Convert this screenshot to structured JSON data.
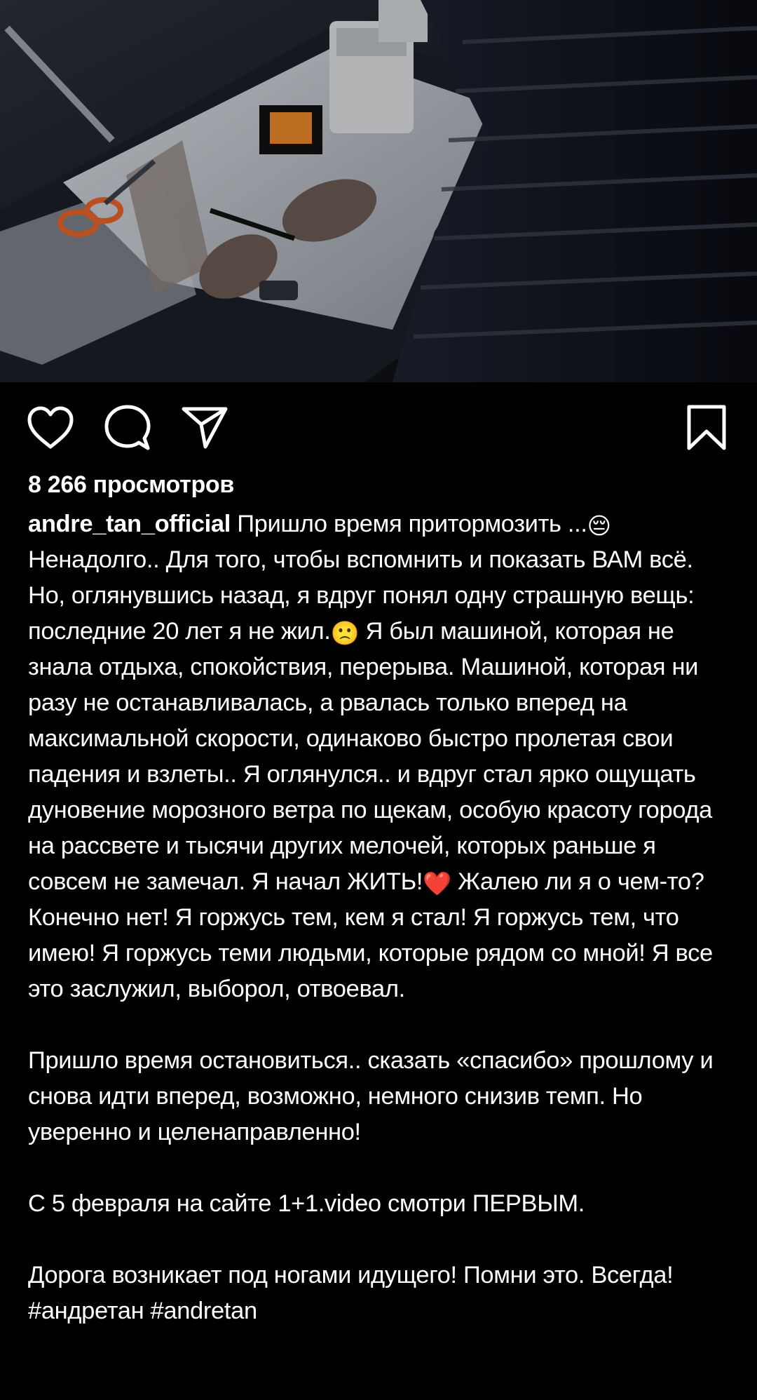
{
  "post": {
    "media": {
      "type": "video-thumbnail"
    },
    "actions": {
      "like_icon": "heart-outline-icon",
      "comment_icon": "speech-bubble-icon",
      "share_icon": "paper-plane-icon",
      "save_icon": "bookmark-outline-icon"
    },
    "views_text": "8 266 просмотров",
    "username": "andre_tan_official",
    "caption": {
      "p1_part1": " Пришло время притормозить ...",
      "emoji1": "😔",
      "p1_part2": " Ненадолго.. Для того, чтобы вспомнить и показать ВАМ всё. Но, оглянувшись назад, я вдруг понял одну страшную вещь: последние 20 лет я не жил.",
      "emoji2": "🙁",
      "p1_part3": " Я был машиной, которая не знала отдыха, спокойствия, перерыва. Машиной, которая ни разу не останавливалась, а рвалась только вперед на максимальной скорости, одинаково быстро пролетая свои падения и взлеты.. Я оглянулся.. и вдруг стал ярко ощущать дуновение морозного ветра по щекам, особую красоту города на рассвете и тысячи других мелочей, которых раньше я совсем не замечал. Я начал ЖИТЬ!",
      "emoji3": "❤️",
      "p1_part4": " Жалею ли я о чем-то? Конечно нет! Я горжусь тем, кем я стал! Я горжусь тем, что имею! Я горжусь теми людьми, которые рядом со мной! Я все это заслужил, выборол, отвоевал.",
      "p2": "Пришло время остановиться.. сказать «спасибо» прошлому и снова идти вперед, возможно, немного снизив темп. Но уверенно и целенаправленно!",
      "p3": "С 5 февраля на сайте 1+1.video смотри ПЕРВЫМ.",
      "p4_text": "Дорога возникает под ногами идущего! Помни это. Всегда! ",
      "hashtag1": "#андретан",
      "hashtag2": "#andretan"
    }
  },
  "colors": {
    "background": "#000000",
    "text": "#ffffff",
    "heart_emoji": "#e0245e"
  }
}
